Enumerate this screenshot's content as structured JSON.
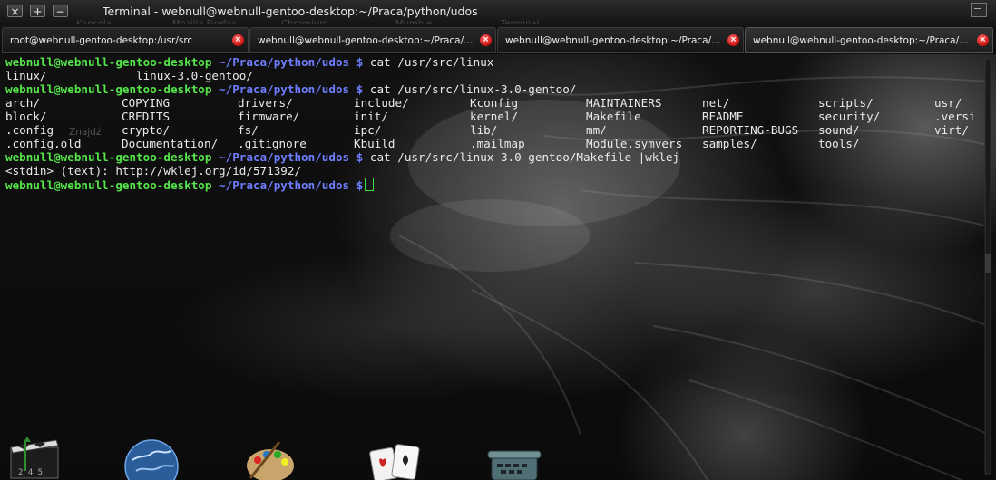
{
  "window": {
    "title": "Terminal - webnull@webnull-gentoo-desktop:~/Praca/python/udos",
    "buttons": {
      "close": "×",
      "maximize": "+",
      "minimize": "−"
    },
    "ghost_taskbar": [
      "Konsola",
      "Mozilla Firefox",
      "Chromium",
      "Mumble",
      "Terminal"
    ]
  },
  "tabs": [
    {
      "label": "root@webnull-gentoo-desktop:/usr/src",
      "active": false
    },
    {
      "label": "webnull@webnull-gentoo-desktop:~/Praca/pyt...",
      "active": false
    },
    {
      "label": "webnull@webnull-gentoo-desktop:~/Praca/pyth...",
      "active": false
    },
    {
      "label": "webnull@webnull-gentoo-desktop:~/Praca/pyth...",
      "active": true
    }
  ],
  "tab_close_glyph": "×",
  "prompt": {
    "user": "webnull@webnull-gentoo-desktop",
    "path": "~/Praca/python/udos",
    "symbol": "$"
  },
  "terminal": {
    "cmd1": "cat /usr/src/linux",
    "out1": [
      "linux/",
      "linux-3.0-gentoo/"
    ],
    "cmd2": "cat /usr/src/linux-3.0-gentoo/",
    "listing": [
      [
        "arch/",
        "COPYING",
        "drivers/",
        "include/",
        "Kconfig",
        "MAINTAINERS",
        "net/",
        "scripts/",
        "usr/"
      ],
      [
        "block/",
        "CREDITS",
        "firmware/",
        "init/",
        "kernel/",
        "Makefile",
        "README",
        "security/",
        ".versi"
      ],
      [
        ".config",
        "crypto/",
        "fs/",
        "ipc/",
        "lib/",
        "mm/",
        "REPORTING-BUGS",
        "sound/",
        "virt/"
      ],
      [
        ".config.old",
        "Documentation/",
        ".gitignore",
        "Kbuild",
        ".mailmap",
        "Module.symvers",
        "samples/",
        "tools/",
        ""
      ]
    ],
    "cmd3": "cat /usr/src/linux-3.0-gentoo/Makefile |wklej",
    "out3": "<stdin> (text): http://wklej.org/id/571392/",
    "ghost_find": "Znajdź"
  },
  "dock": {
    "icons": [
      "film-clapper-icon",
      "globe-icon",
      "paint-palette-icon",
      "playing-cards-icon",
      "typewriter-icon"
    ],
    "clapper_digits": "2 4 5"
  },
  "colors": {
    "user": "#55e64a",
    "path": "#6f7fff",
    "text": "#eaeaea",
    "close": "#c8100c",
    "cursor": "#3be23b"
  }
}
